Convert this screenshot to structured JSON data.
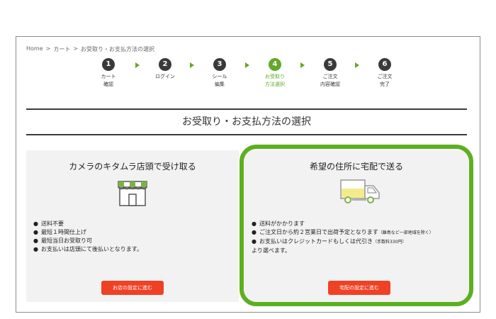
{
  "breadcrumb": [
    "Home",
    "カート",
    "お受取り・お支払方法の選択"
  ],
  "breadcrumb_sep": ">",
  "steps": [
    {
      "num": "1",
      "label": "カート\n確認"
    },
    {
      "num": "2",
      "label": "ログイン"
    },
    {
      "num": "3",
      "label": "シール\n編集"
    },
    {
      "num": "4",
      "label": "お受取り\n方法選択"
    },
    {
      "num": "5",
      "label": "ご注文\n内容確認"
    },
    {
      "num": "6",
      "label": "ご注文\n完了"
    }
  ],
  "active_step": 4,
  "page_title": "お受取り・お支払方法の選択",
  "store": {
    "heading": "カメラのキタムラ店頭で受け取る",
    "items": [
      "送料不要",
      "最短１時間仕上げ",
      "最短当日お受取り可",
      "お支払いは店頭にて後払いとなります。"
    ],
    "button": "お店の設定に進む",
    "icon": "store-icon"
  },
  "delivery": {
    "heading": "希望の住所に宅配で送る",
    "item1": "送料がかかります",
    "item2": "ご注文日から約２営業日で出荷予定となります",
    "item2_note": "（離島など一部地域を除く）",
    "item3": "お支払いはクレジットカードもしくは代引き",
    "item3_note": "（手数料330円）",
    "item3_tail": "より選べます。",
    "button": "宅配の設定に進む",
    "icon": "truck-icon"
  },
  "colors": {
    "accent_green": "#5cb01f",
    "button_red": "#ef4124",
    "step_dark": "#3a3a3a"
  }
}
